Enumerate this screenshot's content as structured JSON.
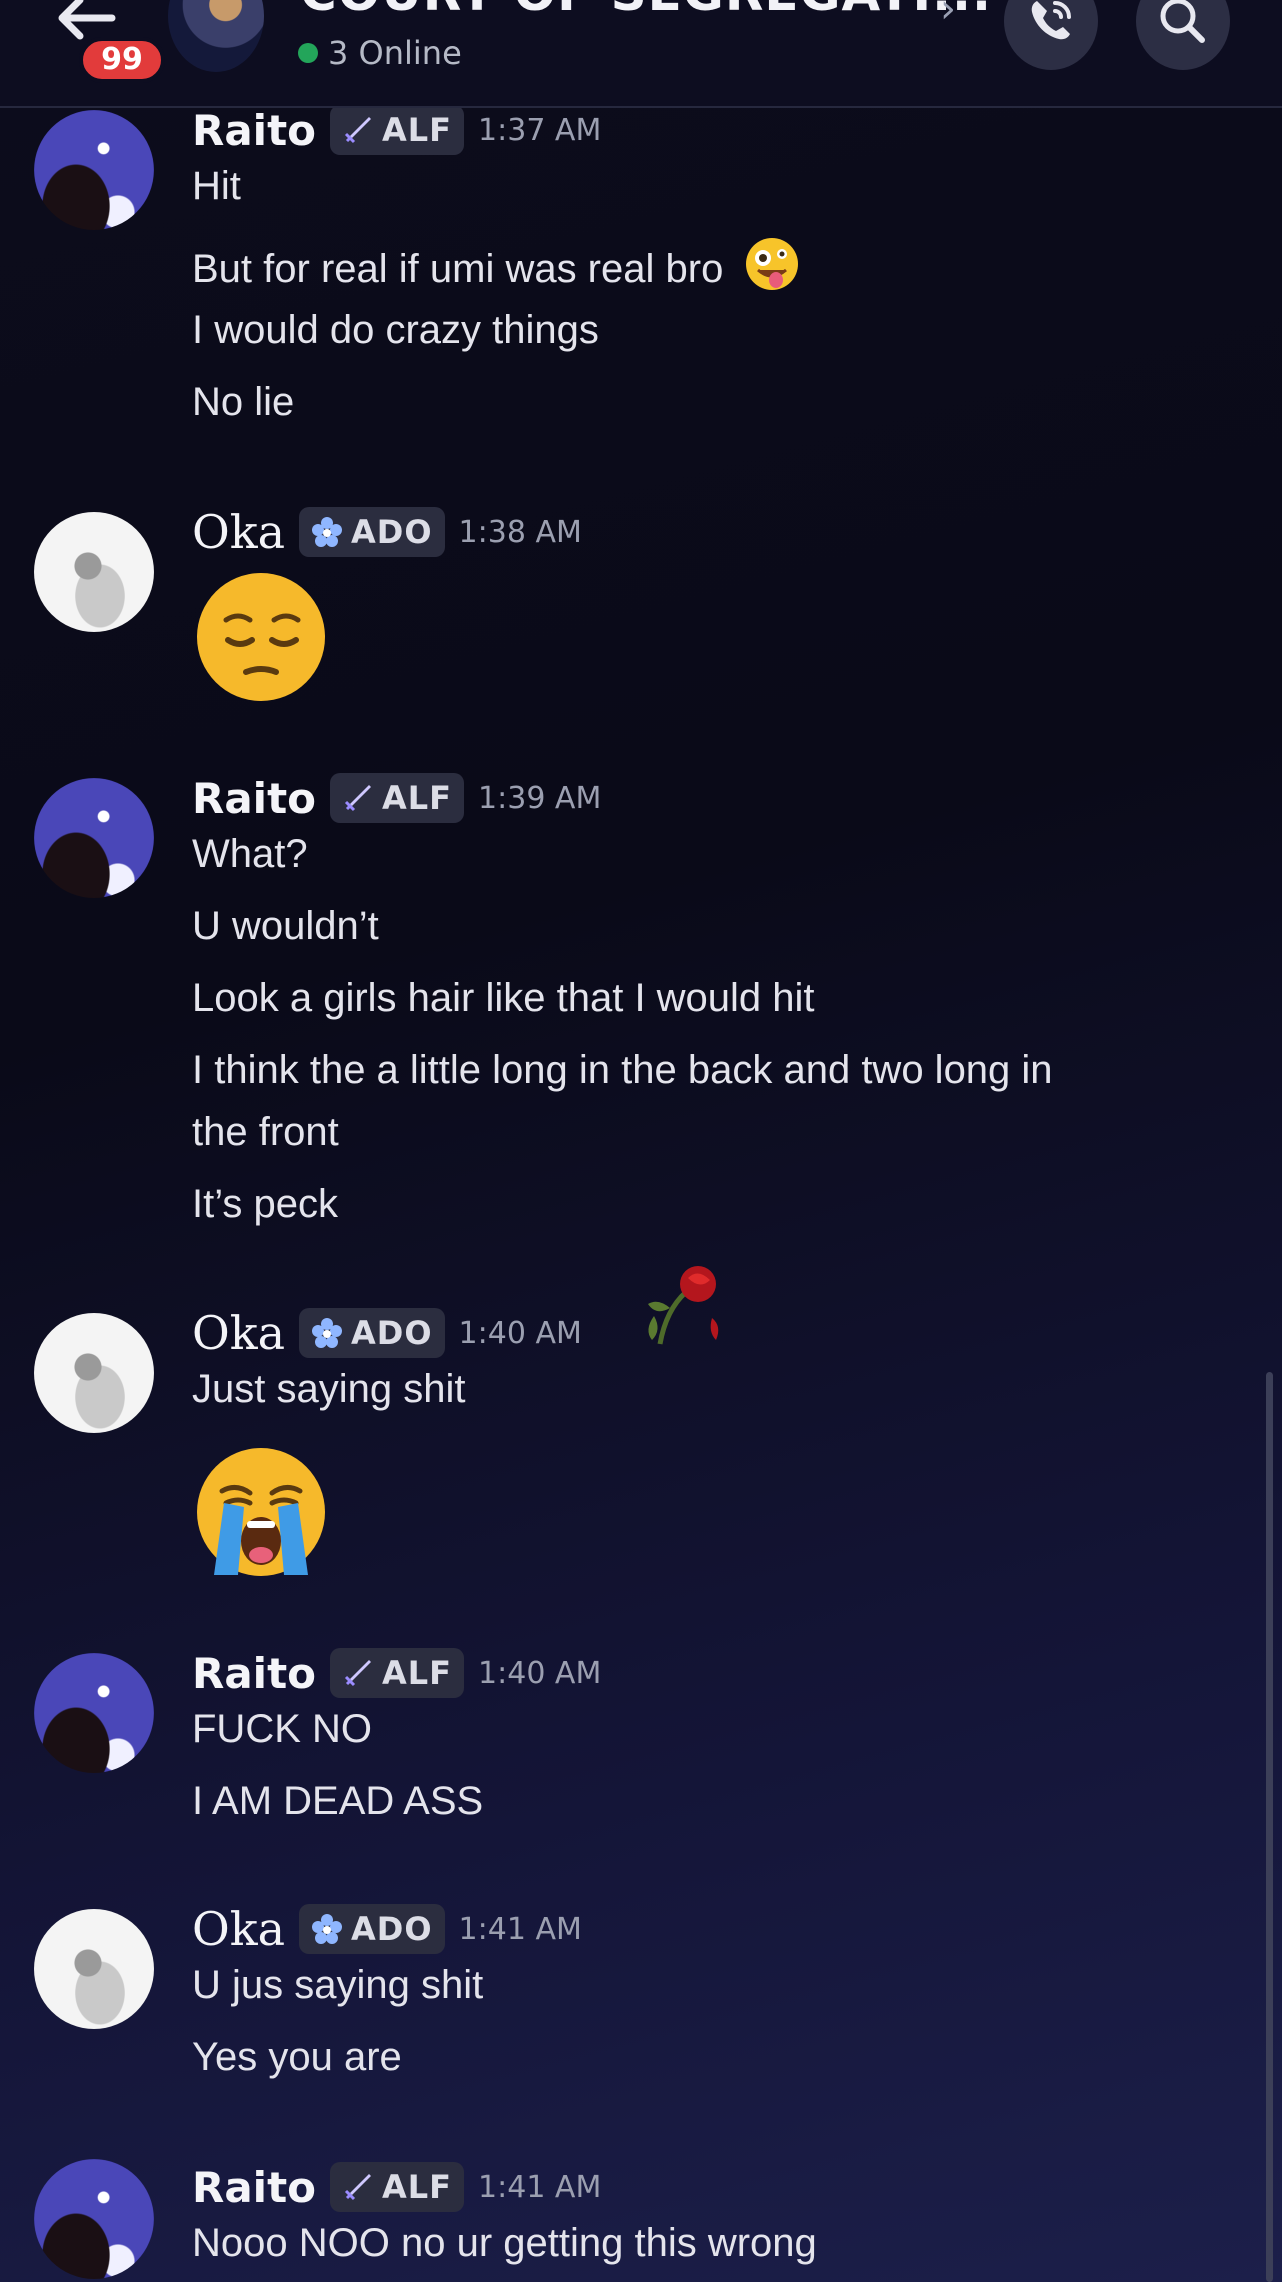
{
  "header": {
    "title": "COURT OF SEGREGATI...",
    "badge_count": "99",
    "online_text": "3 Online"
  },
  "messages": [
    {
      "author": "Raito",
      "tag": "ALF",
      "time": "1:37 AM",
      "lines": [
        "Hit",
        "But for real if umi was real bro",
        "I would do crazy things",
        "No lie"
      ]
    },
    {
      "author": "Oka",
      "tag": "ADO",
      "time": "1:38 AM",
      "emoji": "relieved-face"
    },
    {
      "author": "Raito",
      "tag": "ALF",
      "time": "1:39 AM",
      "lines": [
        "What?",
        "U wouldn’t",
        "Look a girls hair like that I would hit",
        "I think the a little long in the back and two long in",
        "the front",
        "It’s peck"
      ]
    },
    {
      "author": "Oka",
      "tag": "ADO",
      "time": "1:40 AM",
      "lines": [
        "Just saying shit"
      ],
      "emoji": "loudly-crying-face"
    },
    {
      "author": "Raito",
      "tag": "ALF",
      "time": "1:40 AM",
      "lines": [
        "FUCK NO",
        "I AM DEAD ASS"
      ]
    },
    {
      "author": "Oka",
      "tag": "ADO",
      "time": "1:41 AM",
      "lines": [
        "U jus saying shit",
        "Yes you are"
      ]
    },
    {
      "author": "Raito",
      "tag": "ALF",
      "time": "1:41 AM",
      "lines": [
        "Nooo NOO no ur getting this wrong"
      ]
    }
  ],
  "colors": {
    "tag_bg": "#2b2d3f",
    "online_dot": "#23a55a",
    "badge": "#e23b3b"
  }
}
